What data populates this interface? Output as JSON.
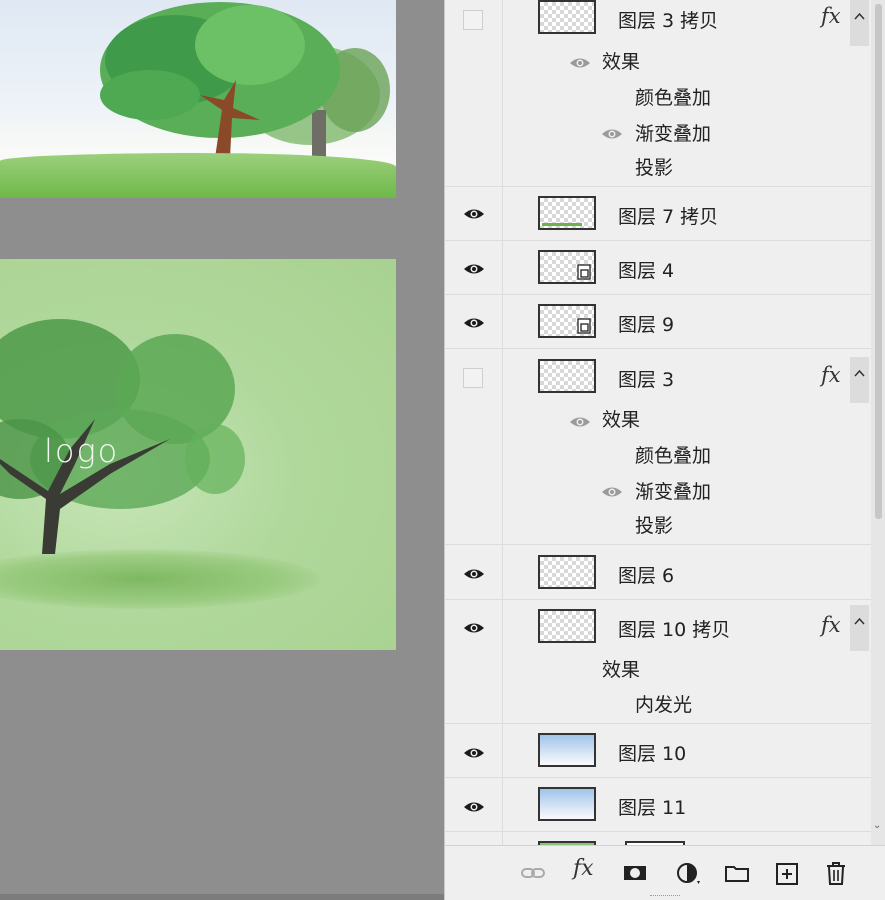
{
  "canvas": {
    "logo_text": "logo"
  },
  "layers_panel": {
    "rows": [
      {
        "name": "图层 3 拷贝",
        "visible": false,
        "has_fx": true,
        "effects_label": "效果",
        "effects": [
          "颜色叠加",
          "渐变叠加",
          "投影"
        ]
      },
      {
        "name": "图层 7 拷贝",
        "visible": true
      },
      {
        "name": "图层 4",
        "visible": true,
        "smart_object": true
      },
      {
        "name": "图层 9",
        "visible": true,
        "smart_object": true
      },
      {
        "name": "图层 3",
        "visible": false,
        "has_fx": true,
        "effects_label": "效果",
        "effects": [
          "颜色叠加",
          "渐变叠加",
          "投影"
        ]
      },
      {
        "name": "图层 6",
        "visible": true
      },
      {
        "name": "图层 10 拷贝",
        "visible": true,
        "has_fx": true,
        "effects_label": "效果",
        "effects": [
          "内发光"
        ]
      },
      {
        "name": "图层 10",
        "visible": true
      },
      {
        "name": "图层 11",
        "visible": true
      }
    ],
    "fx_label": "fx"
  },
  "toolbar": {
    "fx_label": "fx",
    "icons": [
      "link-icon",
      "fx-icon",
      "mask-icon",
      "adjustment-icon",
      "folder-icon",
      "new-layer-icon",
      "trash-icon"
    ]
  }
}
